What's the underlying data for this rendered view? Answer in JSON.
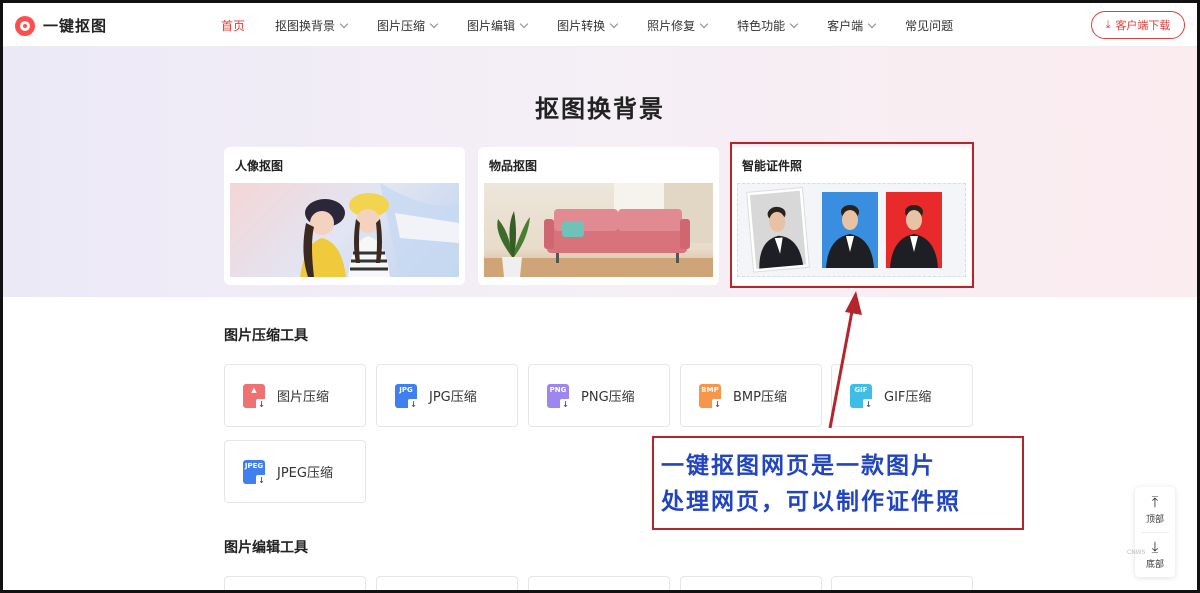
{
  "header": {
    "logo_text": "一键抠图",
    "nav": [
      {
        "label": "首页",
        "active": true,
        "dropdown": false
      },
      {
        "label": "抠图换背景",
        "active": false,
        "dropdown": true
      },
      {
        "label": "图片压缩",
        "active": false,
        "dropdown": true
      },
      {
        "label": "图片编辑",
        "active": false,
        "dropdown": true
      },
      {
        "label": "图片转换",
        "active": false,
        "dropdown": true
      },
      {
        "label": "照片修复",
        "active": false,
        "dropdown": true
      },
      {
        "label": "特色功能",
        "active": false,
        "dropdown": true
      },
      {
        "label": "客户端",
        "active": false,
        "dropdown": true
      },
      {
        "label": "常见问题",
        "active": false,
        "dropdown": false
      }
    ],
    "download_label": "客户端下载"
  },
  "hero": {
    "title": "抠图换背景",
    "cards": [
      {
        "title": "人像抠图"
      },
      {
        "title": "物品抠图"
      },
      {
        "title": "智能证件照"
      }
    ]
  },
  "compress_section": {
    "title": "图片压缩工具",
    "tools": [
      {
        "label": "图片压缩",
        "icon": "image-compress-icon",
        "badge": "",
        "color": "#f07171"
      },
      {
        "label": "JPG压缩",
        "icon": "jpg-file-icon",
        "badge": "JPG",
        "color": "#3f7ff0"
      },
      {
        "label": "PNG压缩",
        "icon": "png-file-icon",
        "badge": "PNG",
        "color": "#9d87ee"
      },
      {
        "label": "BMP压缩",
        "icon": "bmp-file-icon",
        "badge": "BMP",
        "color": "#f7954a"
      },
      {
        "label": "GIF压缩",
        "icon": "gif-file-icon",
        "badge": "GIF",
        "color": "#3dbde8"
      },
      {
        "label": "JPEG压缩",
        "icon": "jpeg-file-icon",
        "badge": "JPEG",
        "color": "#3f7ff0"
      }
    ]
  },
  "edit_section": {
    "title": "图片编辑工具"
  },
  "annotation": {
    "lines": [
      "一键抠图网页是一款图片",
      "处理网页，可以制作证件照"
    ]
  },
  "side_float": {
    "top_label": "顶部",
    "bottom_label": "底部",
    "watermark": "CNWS"
  },
  "colors": {
    "accent": "#e0403a",
    "annotation_red": "#b3262b",
    "annotation_blue": "#2144c0"
  }
}
